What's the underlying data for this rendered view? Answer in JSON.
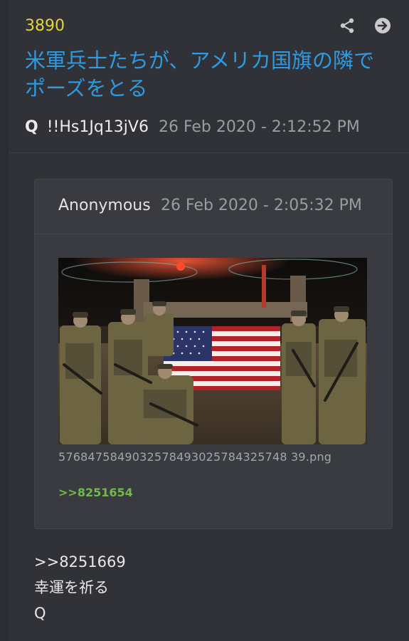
{
  "post": {
    "number": "3890",
    "title": "米軍兵士たちが、アメリカ国旗の隣でポーズをとる",
    "author": "Q",
    "tripcode": "!!Hs1Jq13jV6",
    "date": "26 Feb 2020 - 2:12:52 PM"
  },
  "quoted": {
    "author": "Anonymous",
    "date": "26 Feb 2020 - 2:05:32 PM",
    "filename": "5768475849032578493025784325748 39.png",
    "reply_link": ">>8251654"
  },
  "body": {
    "line1": ">>8251669",
    "line2": "幸運を祈る",
    "line3": "Q"
  },
  "icons": {
    "share": "share-icon",
    "next": "arrow-right-circle-icon"
  },
  "colors": {
    "post_number": "#e3d43c",
    "title": "#2f9ae0",
    "reply_link": "#6fba4b",
    "background": "#303237"
  }
}
